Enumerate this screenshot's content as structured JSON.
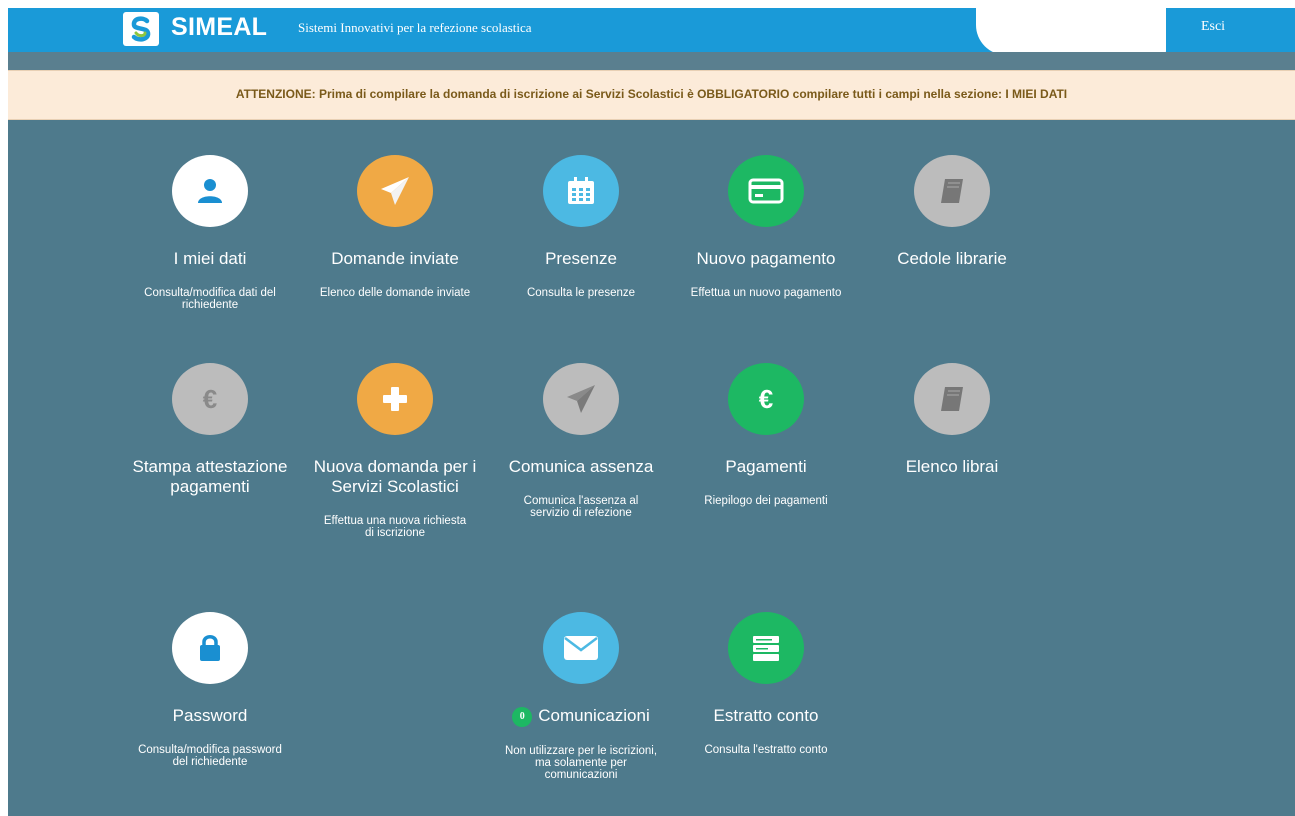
{
  "header": {
    "brand": "SIMEAL",
    "tagline": "Sistemi Innovativi per la refezione scolastica",
    "logout": "Esci"
  },
  "alert": {
    "text": "ATTENZIONE: Prima di compilare la domanda di iscrizione ai Servizi Scolastici è OBBLIGATORIO compilare tutti i campi nella sezione: I MIEI DATI"
  },
  "tiles": [
    {
      "title": "I miei dati",
      "desc": "Consulta/modifica dati del richiedente",
      "icon": "user-icon",
      "color": "#ffffff"
    },
    {
      "title": "Domande inviate",
      "desc": "Elenco delle domande inviate",
      "icon": "paper-plane-icon",
      "color": "#f0a945"
    },
    {
      "title": "Presenze",
      "desc": "Consulta le presenze",
      "icon": "calendar-icon",
      "color": "#4cb9e3"
    },
    {
      "title": "Nuovo pagamento",
      "desc": "Effettua un nuovo pagamento",
      "icon": "credit-card-icon",
      "color": "#1db863"
    },
    {
      "title": "Cedole librarie",
      "desc": "",
      "icon": "book-icon",
      "color": "#bcbcbc"
    },
    {
      "title": "Stampa attestazione pagamenti",
      "desc": "",
      "icon": "euro-icon",
      "color": "#bcbcbc"
    },
    {
      "title": "Nuova domanda per i Servizi Scolastici",
      "desc": "Effettua una nuova richiesta di iscrizione",
      "icon": "plus-icon",
      "color": "#f0a945"
    },
    {
      "title": "Comunica assenza",
      "desc": "Comunica l'assenza al servizio di refezione",
      "icon": "paper-plane-icon",
      "color": "#bcbcbc"
    },
    {
      "title": "Pagamenti",
      "desc": "Riepilogo dei pagamenti",
      "icon": "euro-icon",
      "color": "#1db863"
    },
    {
      "title": "Elenco librai",
      "desc": "",
      "icon": "book-icon",
      "color": "#bcbcbc"
    },
    {
      "title": "Password",
      "desc": "Consulta/modifica password del richiedente",
      "icon": "lock-icon",
      "color": "#ffffff"
    },
    {
      "title": "Comunicazioni",
      "badge": "0",
      "desc": "Non utilizzare per le iscrizioni, ma solamente per comunicazioni",
      "icon": "envelope-icon",
      "color": "#4cb9e3"
    },
    {
      "title": "Estratto conto",
      "desc": "Consulta l'estratto conto",
      "icon": "statement-icon",
      "color": "#1db863"
    }
  ]
}
